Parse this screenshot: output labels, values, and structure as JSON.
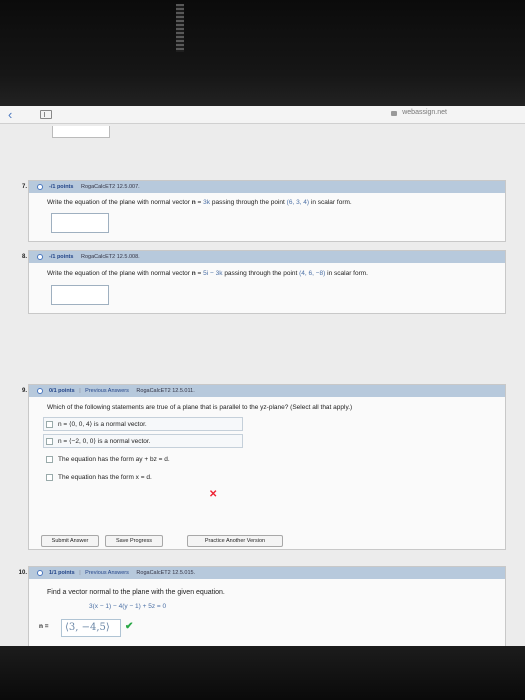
{
  "browser": {
    "url": "webassign.net",
    "back": "‹"
  },
  "q7": {
    "num": "7.",
    "points": "-/1 points",
    "code": "RogaCalcET2 12.5.007.",
    "text_before": "Write the equation of the plane with normal vector ",
    "n_label": "n",
    "eq_sign": " = ",
    "vector": "3k",
    "text_mid": " passing through the point ",
    "point": "(6, 3, 4)",
    "text_after": " in scalar form."
  },
  "q8": {
    "num": "8.",
    "points": "-/1 points",
    "code": "RogaCalcET2 12.5.008.",
    "text_before": "Write the equation of the plane with normal vector ",
    "n_label": "n",
    "eq_sign": " = ",
    "vector": "5i − 3k",
    "text_mid": " passing through the point ",
    "point": "(4, 6, −8)",
    "text_after": " in scalar form."
  },
  "q9": {
    "num": "9.",
    "points": "0/1 points",
    "sep": "|",
    "prev_answers": "Previous Answers",
    "code": "RogaCalcET2 12.5.011.",
    "text": "Which of the following statements are true of a plane that is parallel to the yz-plane? (Select all that apply.)",
    "choices": [
      {
        "label": "n = ⟨0, 0, 4⟩ is a normal vector."
      },
      {
        "label": "n = ⟨−2, 0, 0⟩ is a normal vector."
      },
      {
        "label": "The equation has the form ay + bz = d."
      },
      {
        "label": "The equation has the form x = d."
      }
    ],
    "result": "✕",
    "buttons": {
      "submit": "Submit Answer",
      "save": "Save Progress",
      "practice": "Practice Another Version"
    }
  },
  "q10": {
    "num": "10.",
    "points": "1/1 points",
    "sep": "|",
    "prev_answers": "Previous Answers",
    "code": "RogaCalcET2 12.5.015.",
    "text": "Find a vector normal to the plane with the given equation.",
    "equation": "3(x − 1) − 4(y − 1) + 5z = 0",
    "n_label": "n =",
    "answer": "⟨3, −4,5⟩",
    "result": "✔"
  },
  "colors": {
    "header": "#b7c9dc",
    "link": "#224488",
    "incorrect": "#e23333",
    "correct": "#28a745"
  }
}
